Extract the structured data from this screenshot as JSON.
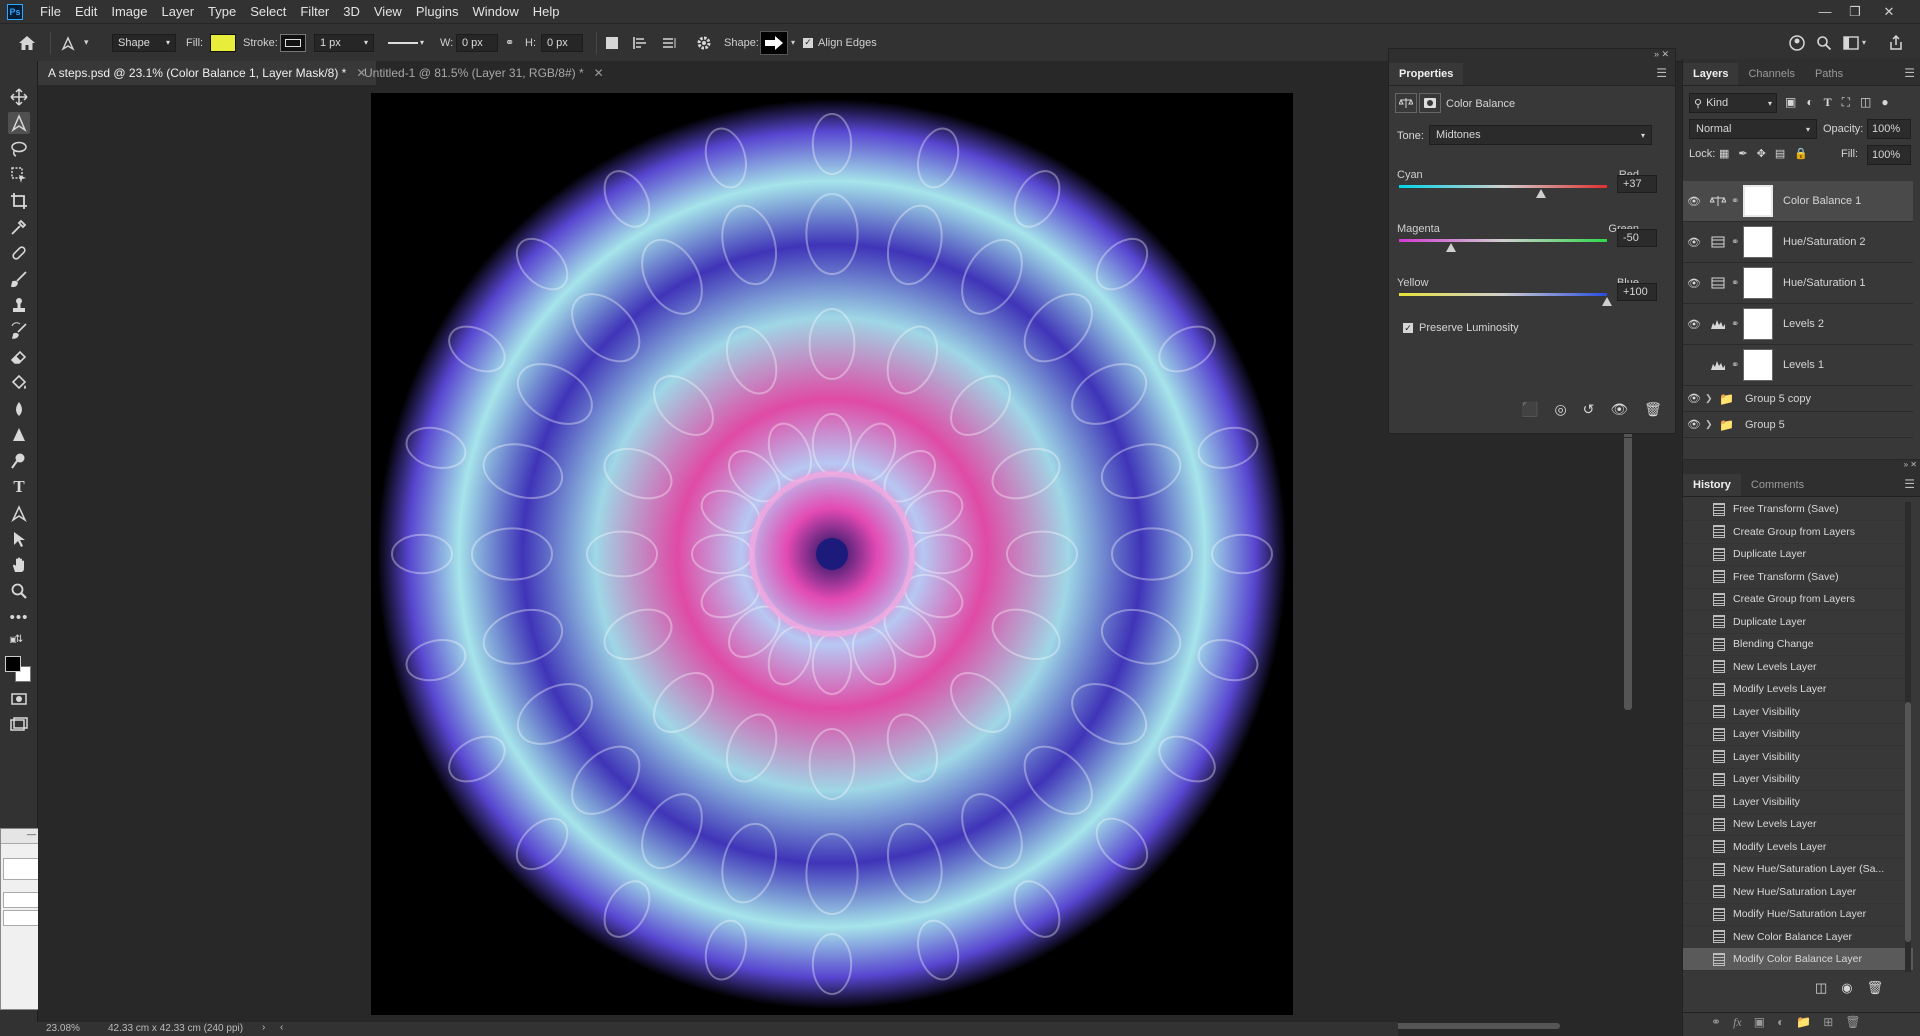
{
  "app": {
    "logo_text": "Ps"
  },
  "menu": [
    "File",
    "Edit",
    "Image",
    "Layer",
    "Type",
    "Select",
    "Filter",
    "3D",
    "View",
    "Plugins",
    "Window",
    "Help"
  ],
  "options_bar": {
    "mode": "Shape",
    "fill_label": "Fill:",
    "fill_color": "#e8ec3a",
    "stroke_label": "Stroke:",
    "stroke_width": "1 px",
    "w_label": "W:",
    "w_value": "0 px",
    "h_label": "H:",
    "h_value": "0 px",
    "shape_label": "Shape:",
    "align_edges": "Align Edges"
  },
  "tabs": [
    {
      "label": "A steps.psd @ 23.1% (Color Balance 1, Layer Mask/8) *",
      "active": true
    },
    {
      "label": "Untitled-1 @ 81.5% (Layer 31, RGB/8#) *",
      "active": false
    }
  ],
  "properties": {
    "title": "Properties",
    "adjustment_name": "Color Balance",
    "tone_label": "Tone:",
    "tone_value": "Midtones",
    "sliders": [
      {
        "left": "Cyan",
        "right": "Red",
        "value": "+37",
        "fraction": 0.685,
        "grad": "linear-gradient(90deg,#00d5e8,#cfcfcf 50%,#e03030)"
      },
      {
        "left": "Magenta",
        "right": "Green",
        "value": "-50",
        "fraction": 0.25,
        "grad": "linear-gradient(90deg,#d23ad2,#cfcfcf 50%,#2ed84a)"
      },
      {
        "left": "Yellow",
        "right": "Blue",
        "value": "+100",
        "fraction": 1.0,
        "grad": "linear-gradient(90deg,#e8e23a,#cfcfcf 50%,#2a4be0)"
      }
    ],
    "preserve_luminosity": "Preserve Luminosity"
  },
  "layers": {
    "tabs": [
      "Layers",
      "Channels",
      "Paths"
    ],
    "filter_kind": "Kind",
    "blend_mode": "Normal",
    "opacity_label": "Opacity:",
    "opacity_value": "100%",
    "lock_label": "Lock:",
    "fill_label": "Fill:",
    "fill_value": "100%",
    "items": [
      {
        "name": "Color Balance 1",
        "visible": true,
        "icon": "balance-icon",
        "selected": true
      },
      {
        "name": "Hue/Saturation 2",
        "visible": true,
        "icon": "huesat-icon",
        "selected": false
      },
      {
        "name": "Hue/Saturation 1",
        "visible": true,
        "icon": "huesat-icon",
        "selected": false
      },
      {
        "name": "Levels 2",
        "visible": true,
        "icon": "levels-icon",
        "selected": false
      },
      {
        "name": "Levels 1",
        "visible": false,
        "icon": "levels-icon",
        "selected": false
      }
    ],
    "groups": [
      {
        "name": "Group 5 copy",
        "visible": true
      },
      {
        "name": "Group 5",
        "visible": true
      }
    ]
  },
  "history": {
    "tabs": [
      "History",
      "Comments"
    ],
    "items": [
      "Free Transform (Save)",
      "Create Group from Layers",
      "Duplicate Layer",
      "Free Transform (Save)",
      "Create Group from Layers",
      "Duplicate Layer",
      "Blending Change",
      "New Levels Layer",
      "Modify Levels Layer",
      "Layer Visibility",
      "Layer Visibility",
      "Layer Visibility",
      "Layer Visibility",
      "Layer Visibility",
      "New Levels Layer",
      "Modify Levels Layer",
      "New Hue/Saturation Layer (Sa...",
      "New Hue/Saturation Layer",
      "Modify Hue/Saturation Layer",
      "New Color Balance Layer",
      "Modify Color Balance Layer"
    ]
  },
  "status": {
    "zoom": "23.08%",
    "doc_size": "42.33 cm x 42.33 cm (240 ppi)"
  },
  "colors": {
    "accent": "#1473e6",
    "foreground": "#000000",
    "background": "#ffffff"
  }
}
